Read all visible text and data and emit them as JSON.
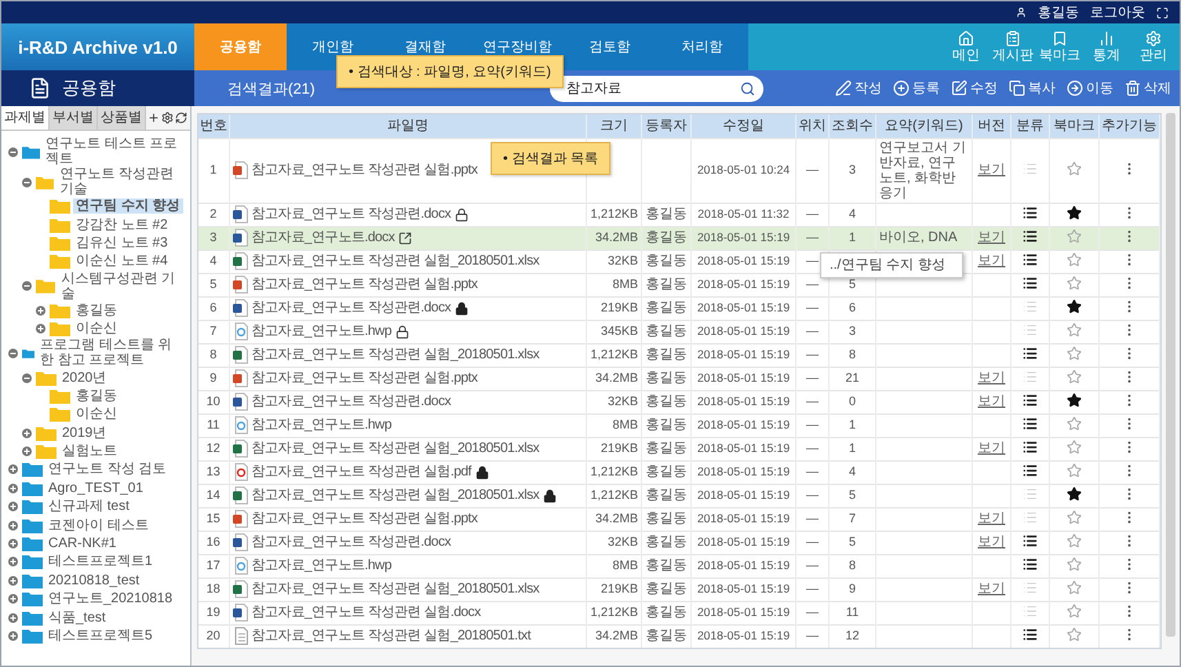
{
  "user_bar": {
    "user": "홍길동",
    "logout": "로그아웃"
  },
  "logo": "i-R&D Archive v1.0",
  "nav_tabs": [
    {
      "label": "공용함",
      "selected": true
    },
    {
      "label": "개인함",
      "selected": false
    },
    {
      "label": "결재함",
      "selected": false
    },
    {
      "label": "연구장비함",
      "selected": false
    },
    {
      "label": "검토함",
      "selected": false
    },
    {
      "label": "처리함",
      "selected": false
    }
  ],
  "nav_icons": [
    {
      "kind": "home",
      "label": "메인"
    },
    {
      "kind": "board",
      "label": "게시판"
    },
    {
      "kind": "bookmark",
      "label": "북마크"
    },
    {
      "kind": "stats",
      "label": "통계"
    },
    {
      "kind": "settings",
      "label": "관리"
    }
  ],
  "section_title": "공용함",
  "result_title": "검색결과(21)",
  "search_callout": "• 검색대상 : 파일명, 요약(키워드)",
  "search": {
    "value": "참고자료"
  },
  "actions": [
    {
      "kind": "write",
      "label": "작성"
    },
    {
      "kind": "add",
      "label": "등록"
    },
    {
      "kind": "edit",
      "label": "수정"
    },
    {
      "kind": "copy",
      "label": "복사"
    },
    {
      "kind": "move",
      "label": "이동"
    },
    {
      "kind": "delete",
      "label": "삭제"
    }
  ],
  "sidebar": {
    "tabs": [
      {
        "label": "과제별",
        "selected": true
      },
      {
        "label": "부서별",
        "selected": false
      },
      {
        "label": "상품별",
        "selected": false
      }
    ],
    "tree": [
      {
        "label": "연구노트 테스트 프로젝트",
        "expanded": true,
        "selected": false,
        "children": [
          {
            "label": "연구노트 작성관련기술",
            "expanded": true,
            "selected": false,
            "children": [
              {
                "label": "연구팀 수지 향성",
                "selected": true
              },
              {
                "label": "강감찬 노트 #2",
                "selected": false
              },
              {
                "label": "김유신 노트 #3",
                "selected": false
              },
              {
                "label": "이순신 노트 #4",
                "selected": false
              }
            ]
          },
          {
            "label": "시스템구성관련 기술",
            "expanded": true,
            "selected": false,
            "children": [
              {
                "label": "홍길동",
                "expanded": false,
                "selected": false
              },
              {
                "label": "이순신",
                "expanded": false,
                "selected": false
              }
            ]
          }
        ]
      },
      {
        "label": "프로그램 테스트를 위한 참고 프로젝트",
        "expanded": true,
        "selected": false,
        "children": [
          {
            "label": "2020년",
            "expanded": true,
            "selected": false,
            "children": [
              {
                "label": "홍길동",
                "selected": false
              },
              {
                "label": "이순신",
                "selected": false
              }
            ]
          },
          {
            "label": "2019년",
            "expanded": false,
            "selected": false
          },
          {
            "label": "실험노트",
            "expanded": false,
            "selected": false
          }
        ]
      },
      {
        "label": "연구노트 작성 검토",
        "expanded": false,
        "selected": false
      },
      {
        "label": "Agro_TEST_01",
        "expanded": false,
        "selected": false
      },
      {
        "label": "신규과제 test",
        "expanded": false,
        "selected": false
      },
      {
        "label": "코젠아이 테스트",
        "expanded": false,
        "selected": false
      },
      {
        "label": "CAR-NK#1",
        "expanded": false,
        "selected": false
      },
      {
        "label": "테스트프로젝트1",
        "expanded": false,
        "selected": false
      },
      {
        "label": "20210818_test",
        "expanded": false,
        "selected": false
      },
      {
        "label": "연구노트_20210818",
        "expanded": false,
        "selected": false
      },
      {
        "label": "식품_test",
        "expanded": false,
        "selected": false
      },
      {
        "label": "테스트프로젝트5",
        "expanded": false,
        "selected": false
      }
    ]
  },
  "table": {
    "columns": [
      "번호",
      "파일명",
      "크기",
      "등록자",
      "수정일",
      "위치",
      "조회수",
      "요약(키워드)",
      "버전",
      "분류",
      "북마크",
      "추가기능"
    ],
    "callout": "• 검색결과 목록",
    "rows": [
      {
        "no": "1",
        "kind": "pptx",
        "name": "참고자료_연구노트 작성관련 실험.pptx",
        "locked": false,
        "shared": false,
        "date": "2018-05-01 10:24",
        "location": "—",
        "views": "3",
        "summary": "연구보고서 기반자료, 연구노트, 화학반응기",
        "version": "보기",
        "classified": false,
        "bookmarked": false,
        "selected": false
      },
      {
        "no": "2",
        "kind": "docx",
        "name": "참고자료_연구노트 작성관련.docx",
        "locked": true,
        "lock_filled": false,
        "shared": false,
        "size": "1,212KB",
        "author": "홍길동",
        "date": "2018-05-01 11:32",
        "location": "—",
        "views": "4",
        "classified": true,
        "bookmarked": true,
        "selected": false
      },
      {
        "no": "3",
        "kind": "docx",
        "name": "참고자료_연구노트.docx",
        "locked": false,
        "shared": true,
        "size": "34.2MB",
        "author": "홍길동",
        "date": "2018-05-01 15:19",
        "location": "—",
        "views": "1",
        "summary": "바이오, DNA",
        "version": "보기",
        "classified": true,
        "bookmarked": false,
        "selected": true
      },
      {
        "no": "4",
        "kind": "xlsx",
        "name": "참고자료_연구노트 작성관련 실험_20180501.xlsx",
        "locked": false,
        "shared": false,
        "size": "32KB",
        "author": "홍길동",
        "date": "2018-05-01 15:19",
        "location": "—",
        "location_popup": "../연구팀 수지 향성",
        "version": "보기",
        "classified": true,
        "bookmarked": false,
        "selected": false
      },
      {
        "no": "5",
        "kind": "pptx",
        "name": "참고자료_연구노트 작성관련 실험.pptx",
        "locked": false,
        "shared": false,
        "size": "8MB",
        "author": "홍길동",
        "date": "2018-05-01 15:19",
        "location": "—",
        "views": "5",
        "classified": true,
        "bookmarked": false,
        "selected": false
      },
      {
        "no": "6",
        "kind": "docx",
        "name": "참고자료_연구노트 작성관련.docx",
        "locked": true,
        "lock_filled": true,
        "shared": false,
        "size": "219KB",
        "author": "홍길동",
        "date": "2018-05-01 15:19",
        "location": "—",
        "views": "6",
        "classified": false,
        "bookmarked": true,
        "selected": false
      },
      {
        "no": "7",
        "kind": "hwp",
        "name": "참고자료_연구노트.hwp",
        "locked": true,
        "lock_filled": false,
        "shared": false,
        "size": "345KB",
        "author": "홍길동",
        "date": "2018-05-01 15:19",
        "location": "—",
        "views": "3",
        "classified": false,
        "bookmarked": false,
        "selected": false
      },
      {
        "no": "8",
        "kind": "xlsx",
        "name": "참고자료_연구노트 작성관련 실험_20180501.xlsx",
        "locked": false,
        "shared": false,
        "size": "1,212KB",
        "author": "홍길동",
        "date": "2018-05-01 15:19",
        "location": "—",
        "views": "8",
        "classified": true,
        "bookmarked": false,
        "selected": false
      },
      {
        "no": "9",
        "kind": "pptx",
        "name": "참고자료_연구노트 작성관련 실험.pptx",
        "locked": false,
        "shared": false,
        "size": "34.2MB",
        "author": "홍길동",
        "date": "2018-05-01 15:19",
        "location": "—",
        "views": "21",
        "version": "보기",
        "classified": false,
        "bookmarked": false,
        "selected": false
      },
      {
        "no": "10",
        "kind": "docx",
        "name": "참고자료_연구노트 작성관련.docx",
        "locked": false,
        "shared": false,
        "size": "32KB",
        "author": "홍길동",
        "date": "2018-05-01 15:19",
        "location": "—",
        "views": "0",
        "version": "보기",
        "classified": true,
        "bookmarked": true,
        "selected": false
      },
      {
        "no": "11",
        "kind": "hwp",
        "name": "참고자료_연구노트.hwp",
        "locked": false,
        "shared": false,
        "size": "8MB",
        "author": "홍길동",
        "date": "2018-05-01 15:19",
        "location": "—",
        "views": "1",
        "classified": true,
        "bookmarked": false,
        "selected": false
      },
      {
        "no": "12",
        "kind": "xlsx",
        "name": "참고자료_연구노트 작성관련 실험_20180501.xlsx",
        "locked": false,
        "shared": false,
        "size": "219KB",
        "author": "홍길동",
        "date": "2018-05-01 15:19",
        "location": "—",
        "views": "1",
        "version": "보기",
        "classified": true,
        "bookmarked": false,
        "selected": false
      },
      {
        "no": "13",
        "kind": "pdf",
        "name": "참고자료_연구노트 작성관련 실험.pdf",
        "locked": true,
        "lock_filled": true,
        "shared": false,
        "size": "1,212KB",
        "author": "홍길동",
        "date": "2018-05-01 15:19",
        "location": "—",
        "views": "4",
        "classified": true,
        "bookmarked": false,
        "selected": false
      },
      {
        "no": "14",
        "kind": "xlsx",
        "name": "참고자료_연구노트 작성관련 실험_20180501.xlsx",
        "locked": true,
        "lock_filled": true,
        "shared": false,
        "size": "1,212KB",
        "author": "홍길동",
        "date": "2018-05-01 15:19",
        "location": "—",
        "views": "5",
        "classified": false,
        "bookmarked": true,
        "selected": false
      },
      {
        "no": "15",
        "kind": "pptx",
        "name": "참고자료_연구노트 작성관련 실험.pptx",
        "locked": false,
        "shared": false,
        "size": "34.2MB",
        "author": "홍길동",
        "date": "2018-05-01 15:19",
        "location": "—",
        "views": "7",
        "version": "보기",
        "classified": false,
        "bookmarked": false,
        "selected": false
      },
      {
        "no": "16",
        "kind": "docx",
        "name": "참고자료_연구노트 작성관련.docx",
        "locked": false,
        "shared": false,
        "size": "32KB",
        "author": "홍길동",
        "date": "2018-05-01 15:19",
        "location": "—",
        "views": "5",
        "version": "보기",
        "classified": true,
        "bookmarked": false,
        "selected": false
      },
      {
        "no": "17",
        "kind": "hwp",
        "name": "참고자료_연구노트.hwp",
        "locked": false,
        "shared": false,
        "size": "8MB",
        "author": "홍길동",
        "date": "2018-05-01 15:19",
        "location": "—",
        "views": "8",
        "classified": true,
        "bookmarked": false,
        "selected": false
      },
      {
        "no": "18",
        "kind": "xlsx",
        "name": "참고자료_연구노트 작성관련 실험_20180501.xlsx",
        "locked": false,
        "shared": false,
        "size": "219KB",
        "author": "홍길동",
        "date": "2018-05-01 15:19",
        "location": "—",
        "views": "9",
        "version": "보기",
        "classified": false,
        "bookmarked": false,
        "selected": false
      },
      {
        "no": "19",
        "kind": "docx",
        "name": "참고자료_연구노트 작성관련 실험.docx",
        "locked": false,
        "shared": false,
        "size": "1,212KB",
        "author": "홍길동",
        "date": "2018-05-01 15:19",
        "location": "—",
        "views": "11",
        "classified": false,
        "bookmarked": false,
        "selected": false
      },
      {
        "no": "20",
        "kind": "txt",
        "name": "참고자료_연구노트 작성관련 실험_20180501.txt",
        "locked": false,
        "shared": false,
        "size": "34.2MB",
        "author": "홍길동",
        "date": "2018-05-01 15:19",
        "location": "—",
        "views": "12",
        "classified": true,
        "bookmarked": false,
        "selected": false
      }
    ]
  }
}
